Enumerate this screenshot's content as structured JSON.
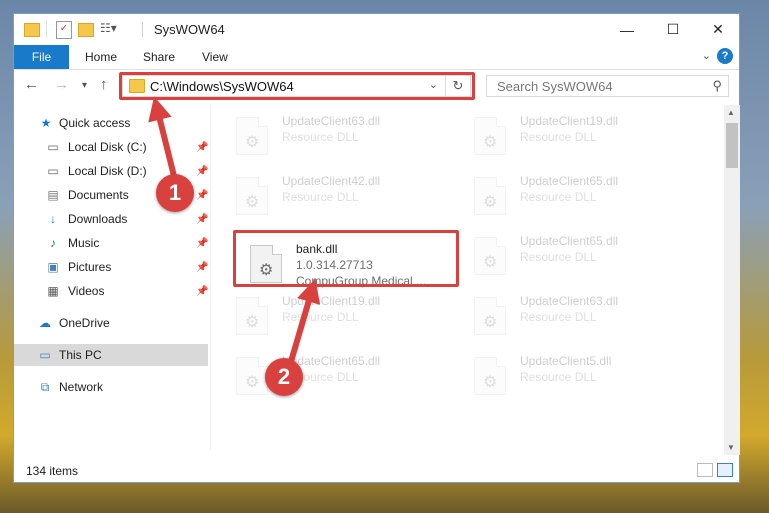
{
  "window": {
    "title": "SysWOW64",
    "buttons": {
      "minimize": "—",
      "maximize": "☐",
      "close": "✕"
    }
  },
  "ribbon": {
    "tabs": [
      "File",
      "Home",
      "Share",
      "View"
    ],
    "help": "?"
  },
  "address": {
    "path": "C:\\Windows\\SysWOW64",
    "search_placeholder": "Search SysWOW64"
  },
  "sidebar": {
    "items": [
      {
        "label": "Quick access",
        "icon": "star-icon",
        "pinned": false
      },
      {
        "label": "Local Disk (C:)",
        "icon": "drive-icon",
        "pinned": true
      },
      {
        "label": "Local Disk (D:)",
        "icon": "drive-icon",
        "pinned": true
      },
      {
        "label": "Documents",
        "icon": "documents-icon",
        "pinned": true
      },
      {
        "label": "Downloads",
        "icon": "download-icon",
        "pinned": true
      },
      {
        "label": "Music",
        "icon": "music-icon",
        "pinned": true
      },
      {
        "label": "Pictures",
        "icon": "pictures-icon",
        "pinned": true
      },
      {
        "label": "Videos",
        "icon": "videos-icon",
        "pinned": true
      },
      {
        "label": "OneDrive",
        "icon": "cloud-icon",
        "pinned": false
      },
      {
        "label": "This PC",
        "icon": "computer-icon",
        "pinned": false,
        "selected": true
      },
      {
        "label": "Network",
        "icon": "network-icon",
        "pinned": false
      }
    ]
  },
  "files": [
    {
      "name": "UpdateClient63.dll",
      "line2": "Resource DLL",
      "line3": ""
    },
    {
      "name": "UpdateClient19.dll",
      "line2": "Resource DLL",
      "line3": ""
    },
    {
      "name": "UpdateClient42.dll",
      "line2": "Resource DLL",
      "line3": ""
    },
    {
      "name": "UpdateClient65.dll",
      "line2": "Resource DLL",
      "line3": ""
    },
    {
      "name": "bank.dll",
      "line2": "1.0.314.27713",
      "line3": "CompuGroup Medical ..."
    },
    {
      "name": "UpdateClient65.dll",
      "line2": "Resource DLL",
      "line3": ""
    },
    {
      "name": "UpdateClient19.dll",
      "line2": "Resource DLL",
      "line3": ""
    },
    {
      "name": "UpdateClient63.dll",
      "line2": "Resource DLL",
      "line3": ""
    },
    {
      "name": "UpdateClient65.dll",
      "line2": "Resource DLL",
      "line3": ""
    },
    {
      "name": "UpdateClient5.dll",
      "line2": "Resource DLL",
      "line3": ""
    }
  ],
  "status": {
    "item_count": "134 items"
  },
  "annotations": {
    "step1": "1",
    "step2": "2"
  },
  "colors": {
    "highlight": "#d9413f",
    "file_tab": "#1979ca"
  }
}
